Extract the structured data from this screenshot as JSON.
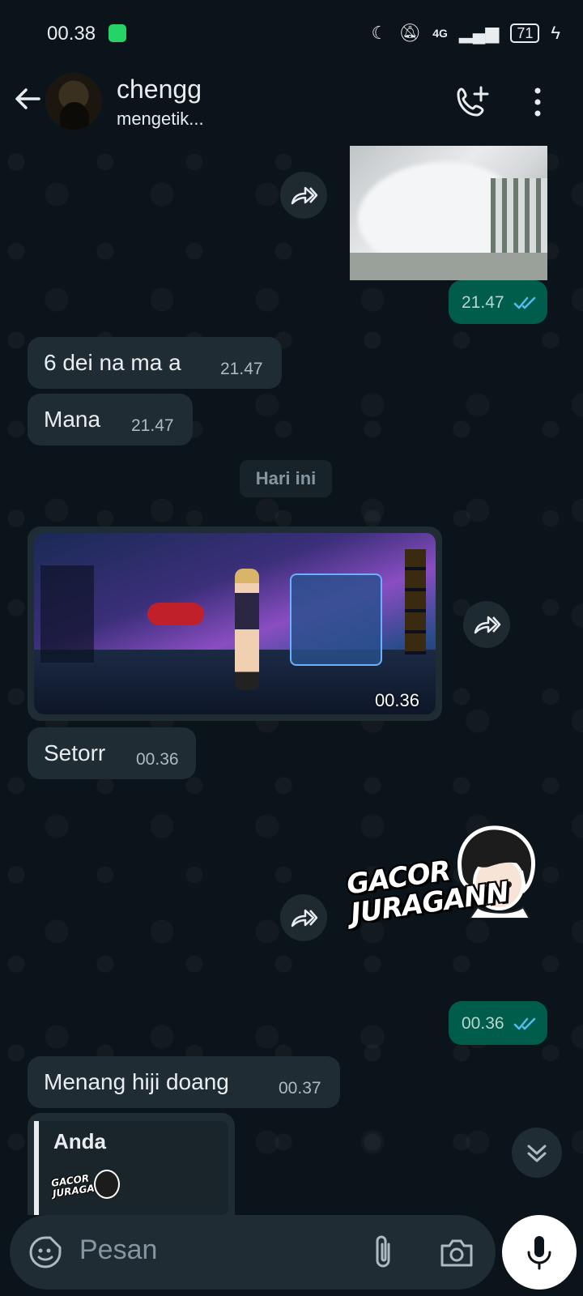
{
  "status_bar": {
    "time": "00.38",
    "network": "4G",
    "battery": "71"
  },
  "header": {
    "contact_name": "chengg",
    "contact_status": "mengetik..."
  },
  "messages": [
    {
      "direction": "out",
      "type": "image",
      "time": "21.47",
      "read": true
    },
    {
      "direction": "in",
      "type": "text",
      "text": "6 dei na ma a",
      "time": "21.47"
    },
    {
      "direction": "in",
      "type": "text",
      "text": "Mana",
      "time": "21.47"
    },
    {
      "type": "date",
      "label": "Hari ini"
    },
    {
      "direction": "in",
      "type": "image",
      "time": "00.36"
    },
    {
      "direction": "in",
      "type": "text",
      "text": "Setorr",
      "time": "00.36"
    },
    {
      "direction": "out",
      "type": "sticker",
      "sticker_text": "GACOR JURAGANN",
      "time": "00.36",
      "read": true
    },
    {
      "direction": "in",
      "type": "text",
      "text": "Menang hiji doang",
      "time": "00.37"
    },
    {
      "direction": "in",
      "type": "reply",
      "quoted_author": "Anda",
      "quoted_sticker_text": "GACOR JURAGANN"
    }
  ],
  "composer": {
    "placeholder": "Pesan"
  },
  "colors": {
    "background": "#0b141a",
    "incoming_bubble": "#202c33",
    "outgoing_bubble": "#005c4b",
    "read_ticks": "#53bdeb"
  },
  "icons": [
    "back-arrow-icon",
    "add-call-icon",
    "more-options-icon",
    "forward-icon",
    "double-check-icon",
    "scroll-down-icon",
    "emoji-sticker-icon",
    "attach-icon",
    "camera-icon",
    "mic-icon"
  ]
}
